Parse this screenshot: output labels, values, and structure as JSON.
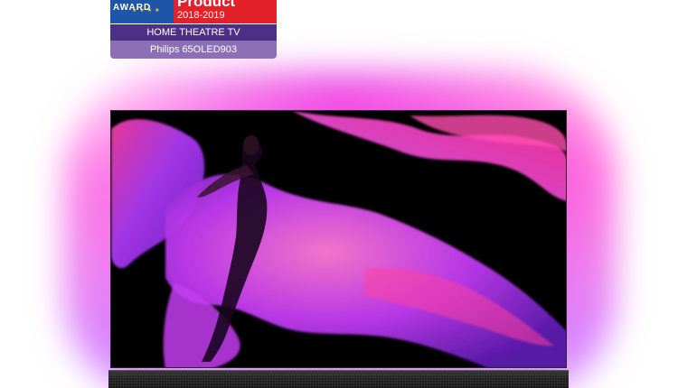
{
  "award": {
    "award_word": "AWARD",
    "product_word": "Product",
    "year_range": "2018-2019",
    "category": "HOME THEATRE TV",
    "model": "Philips 65OLED903",
    "colors": {
      "blue": "#1f55a8",
      "red": "#e3212a",
      "purple_dark": "#4d2f86",
      "purple_light": "#8d6fb6"
    }
  },
  "tv": {
    "ambilight_color": "#e45ae8",
    "screen_subject": "dancer with flowing magenta and purple fabric"
  }
}
